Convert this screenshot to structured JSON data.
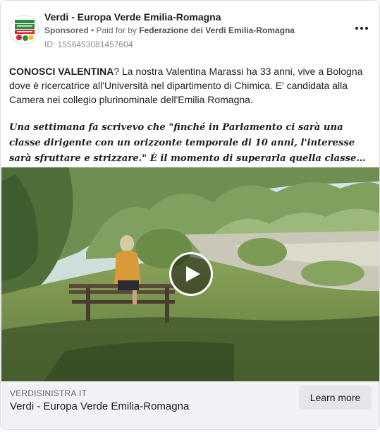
{
  "header": {
    "page_name": "Verdi - Europa Verde Emilia-Romagna",
    "sponsored": "Sponsored",
    "separator": " • ",
    "paid_for_prefix": "Paid for by ",
    "funder": "Federazione dei Verdi Emilia-Romagna",
    "ad_id": "ID: 1556453081457604",
    "avatar_logo_text": "Verdi Sinistra",
    "more_icon": "more-horizontal-icon"
  },
  "post": {
    "intro_bold": "CONOSCI VALENTINA",
    "intro_rest": "? La nostra Valentina Marassi ha 33 anni, vive a Bologna dove è ricercatrice all'Università nel dipartimento di Chimica. E' candidata alla Camera nei collegio plurinominale dell'Emilia Romagna.",
    "quote": "Una settimana fa scrivevo che \"finché in Parlamento ci sarà una classe dirigente con un orizzonte temporale di 10 anni, l'interesse sarà sfruttare e strizzare.\" È il momento di superarla quella classe…"
  },
  "media": {
    "type": "video",
    "play_icon": "play-icon"
  },
  "footer": {
    "domain": "VERDISINISTRA.IT",
    "title": "Verdi - Europa Verde Emilia-Romagna",
    "cta_label": "Learn more"
  },
  "colors": {
    "brand_green": "#2e8b3a",
    "brand_red": "#d7262e",
    "footer_bg": "#f0f2f5",
    "cta_bg": "#e4e6eb"
  }
}
